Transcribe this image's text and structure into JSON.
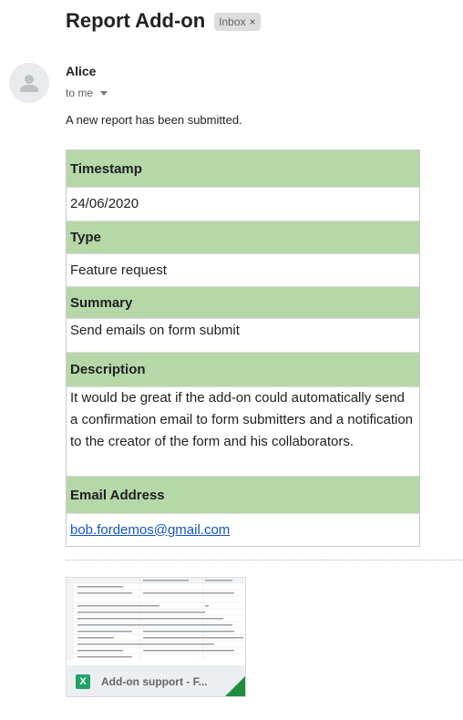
{
  "message": {
    "subject": "Report Add-on",
    "label": "Inbox",
    "label_remove_icon": "close-icon",
    "sender": "Alice",
    "recipient": "to me",
    "intro": "A new report has been submitted."
  },
  "report": {
    "header_color": "#b6d7a8",
    "fields": [
      {
        "label": "Timestamp",
        "value": "24/06/2020"
      },
      {
        "label": "Type",
        "value": "Feature request"
      },
      {
        "label": "Summary",
        "value": "Send emails on form submit"
      },
      {
        "label": "Description",
        "value": "It would be great if the add-on could automatically send a confirmation email to form submitters and a notification to the creator of the form and his collaborators."
      },
      {
        "label": "Email Address",
        "value": "bob.fordemos@gmail.com"
      }
    ]
  },
  "attachment": {
    "name": "Add-on support - F...",
    "icon": "excel-icon",
    "icon_letter": "X",
    "accent_color": "#1e8e3e"
  }
}
